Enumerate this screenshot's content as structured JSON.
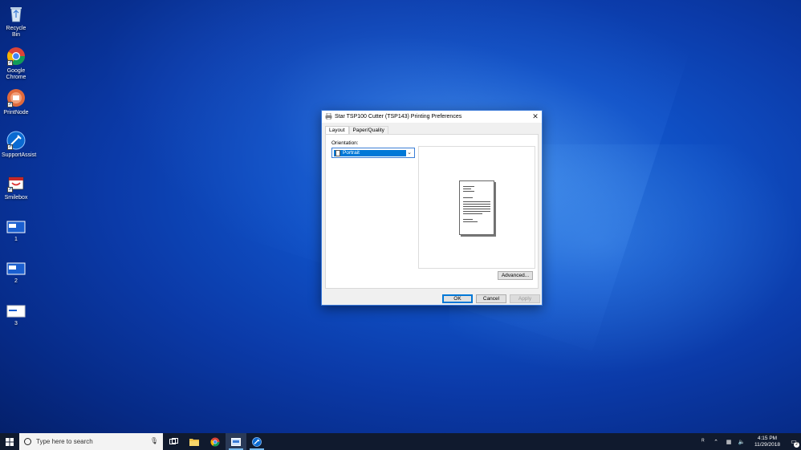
{
  "desktop": {
    "icons": [
      {
        "label": "Recycle Bin",
        "icon": "recycle-bin-icon"
      },
      {
        "label": "Google Chrome",
        "icon": "chrome-icon"
      },
      {
        "label": "PrintNode",
        "icon": "printnode-icon"
      },
      {
        "label": "SupportAssist",
        "icon": "supportassist-icon"
      },
      {
        "label": "Smilebox",
        "icon": "smilebox-icon"
      },
      {
        "label": "1",
        "icon": "window-shortcut-icon"
      },
      {
        "label": "2",
        "icon": "window-shortcut-icon"
      },
      {
        "label": "3",
        "icon": "window-shortcut-icon"
      }
    ]
  },
  "dialog": {
    "title": "Star TSP100 Cutter (TSP143) Printing Preferences",
    "tabs": [
      {
        "label": "Layout",
        "active": true
      },
      {
        "label": "Paper/Quality",
        "active": false
      }
    ],
    "orientation": {
      "label": "Orientation:",
      "selected": "Portrait"
    },
    "advanced_label": "Advanced...",
    "buttons": {
      "ok": "OK",
      "cancel": "Cancel",
      "apply": "Apply"
    }
  },
  "taskbar": {
    "search_placeholder": "Type here to search",
    "apps": [
      "task-view-icon",
      "file-explorer-icon",
      "chrome-icon",
      "printer-settings-icon",
      "supportassist-icon"
    ],
    "clock": {
      "time": "4:15 PM",
      "date": "11/29/2018"
    },
    "notification_count": "2"
  },
  "colors": {
    "accent": "#0078d7",
    "taskbar": "#101a2e"
  }
}
